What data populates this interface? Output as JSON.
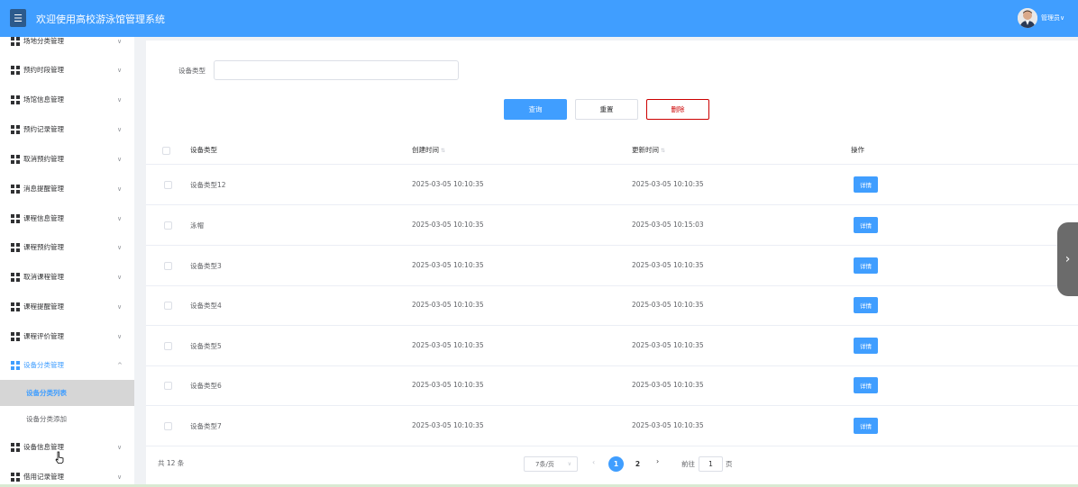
{
  "header": {
    "title": "欢迎使用高校游泳馆管理系统",
    "admin": "管理员",
    "admin_caret": "∨"
  },
  "sidebar": {
    "items": [
      {
        "label": "场地分类管理",
        "chevron": "∨"
      },
      {
        "label": "预约时段管理",
        "chevron": "∨"
      },
      {
        "label": "场馆信息管理",
        "chevron": "∨"
      },
      {
        "label": "预约记录管理",
        "chevron": "∨"
      },
      {
        "label": "取消预约管理",
        "chevron": "∨"
      },
      {
        "label": "消息提醒管理",
        "chevron": "∨"
      },
      {
        "label": "课程信息管理",
        "chevron": "∨"
      },
      {
        "label": "课程预约管理",
        "chevron": "∨"
      },
      {
        "label": "取消课程管理",
        "chevron": "∨"
      },
      {
        "label": "课程提醒管理",
        "chevron": "∨"
      },
      {
        "label": "课程评价管理",
        "chevron": "∨"
      },
      {
        "label": "设备分类管理",
        "chevron": "^"
      },
      {
        "label": "设备信息管理",
        "chevron": "∨"
      },
      {
        "label": "借用记录管理",
        "chevron": "∨"
      }
    ],
    "subitems": [
      {
        "label": "设备分类列表"
      },
      {
        "label": "设备分类添加"
      }
    ]
  },
  "filter": {
    "label": "设备类型",
    "value": ""
  },
  "buttons": {
    "query": "查询",
    "reset": "重置",
    "delete": "删除"
  },
  "table": {
    "columns": [
      "设备类型",
      "创建时间",
      "更新时间",
      "操作"
    ],
    "sort_icon": "⇅",
    "rows": [
      {
        "type": "设备类型12",
        "created": "2025-03-05 10:10:35",
        "updated": "2025-03-05 10:10:35",
        "action": "详情"
      },
      {
        "type": "泳帽",
        "created": "2025-03-05 10:10:35",
        "updated": "2025-03-05 10:15:03",
        "action": "详情"
      },
      {
        "type": "设备类型3",
        "created": "2025-03-05 10:10:35",
        "updated": "2025-03-05 10:10:35",
        "action": "详情"
      },
      {
        "type": "设备类型4",
        "created": "2025-03-05 10:10:35",
        "updated": "2025-03-05 10:10:35",
        "action": "详情"
      },
      {
        "type": "设备类型5",
        "created": "2025-03-05 10:10:35",
        "updated": "2025-03-05 10:10:35",
        "action": "详情"
      },
      {
        "type": "设备类型6",
        "created": "2025-03-05 10:10:35",
        "updated": "2025-03-05 10:10:35",
        "action": "详情"
      },
      {
        "type": "设备类型7",
        "created": "2025-03-05 10:10:35",
        "updated": "2025-03-05 10:10:35",
        "action": "详情"
      }
    ]
  },
  "pagination": {
    "total": "共 12 条",
    "page_size": "7条/页",
    "prev": "‹",
    "next": "›",
    "pages": [
      "1",
      "2"
    ],
    "goto_label": "前往",
    "goto_value": "1",
    "goto_unit": "页"
  },
  "side_handle": "›",
  "colors": {
    "primary": "#409eff",
    "danger": "#cc0000",
    "sidebar_selected": "#d6d6d6"
  }
}
